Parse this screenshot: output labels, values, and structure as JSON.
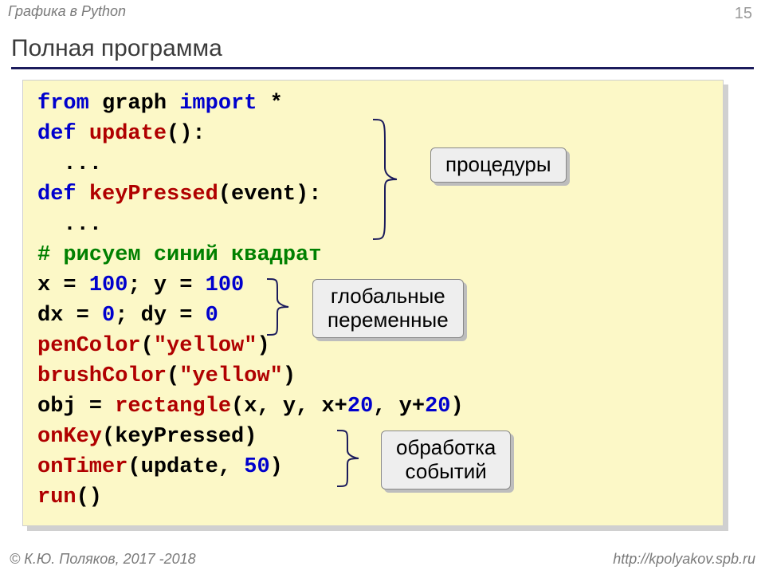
{
  "header": {
    "topic": "Графика в Python",
    "page_number": "15",
    "title": "Полная программа"
  },
  "code": {
    "l1_a": "from",
    "l1_b": " graph ",
    "l1_c": "import",
    "l1_d": " *",
    "l2_a": "def",
    "l2_b": " ",
    "l2_c": "update",
    "l2_d": "():",
    "l3": "  ...",
    "l4_a": "def",
    "l4_b": " ",
    "l4_c": "keyPressed",
    "l4_d": "(event):",
    "l5": "  ...",
    "l6": "# рисуем синий квадрат",
    "l7_a": "x = ",
    "l7_b": "100",
    "l7_c": "; y = ",
    "l7_d": "100",
    "l8_a": "dx = ",
    "l8_b": "0",
    "l8_c": "; dy = ",
    "l8_d": "0",
    "l9_a": "penColor",
    "l9_b": "(",
    "l9_c": "\"yellow\"",
    "l9_d": ")",
    "l10_a": "brushColor",
    "l10_b": "(",
    "l10_c": "\"yellow\"",
    "l10_d": ")",
    "l11_a": "obj = ",
    "l11_b": "rectangle",
    "l11_c": "(x, y, x+",
    "l11_d": "20",
    "l11_e": ", y+",
    "l11_f": "20",
    "l11_g": ")",
    "l12_a": "onKey",
    "l12_b": "(keyPressed)",
    "l13_a": "onTimer",
    "l13_b": "(update, ",
    "l13_c": "50",
    "l13_d": ")",
    "l14_a": "run",
    "l14_b": "()"
  },
  "callouts": {
    "c1": "процедуры",
    "c2": "глобальные\nпеременные",
    "c3": "обработка\nсобытий"
  },
  "footer": {
    "left": "© К.Ю. Поляков, 2017 -2018",
    "right": "http://kpolyakov.spb.ru"
  }
}
